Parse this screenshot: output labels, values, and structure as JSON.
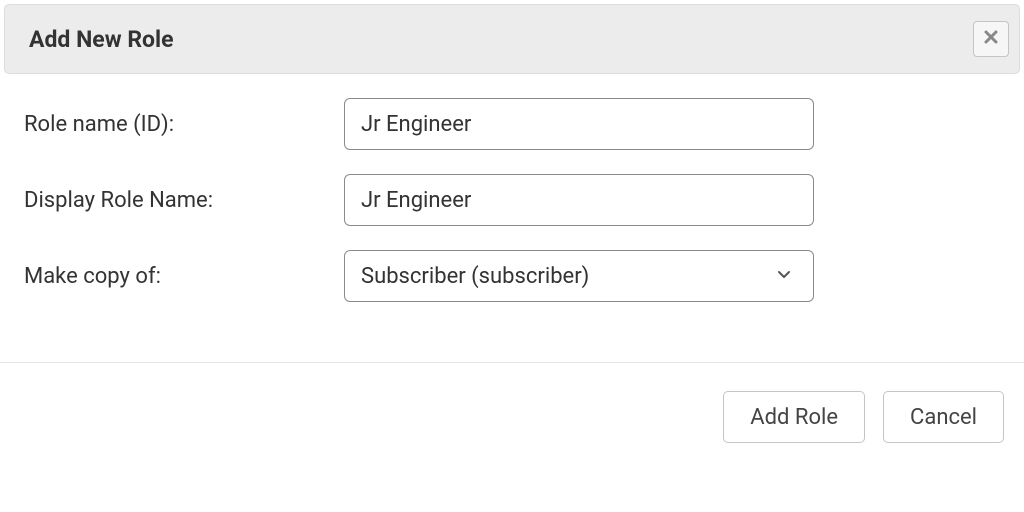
{
  "dialog": {
    "title": "Add New Role"
  },
  "form": {
    "role_name": {
      "label": "Role name (ID):",
      "value": "Jr Engineer"
    },
    "display_name": {
      "label": "Display Role Name:",
      "value": "Jr Engineer"
    },
    "copy_of": {
      "label": "Make copy of:",
      "selected": "Subscriber (subscriber)"
    }
  },
  "buttons": {
    "add_role": "Add Role",
    "cancel": "Cancel"
  }
}
